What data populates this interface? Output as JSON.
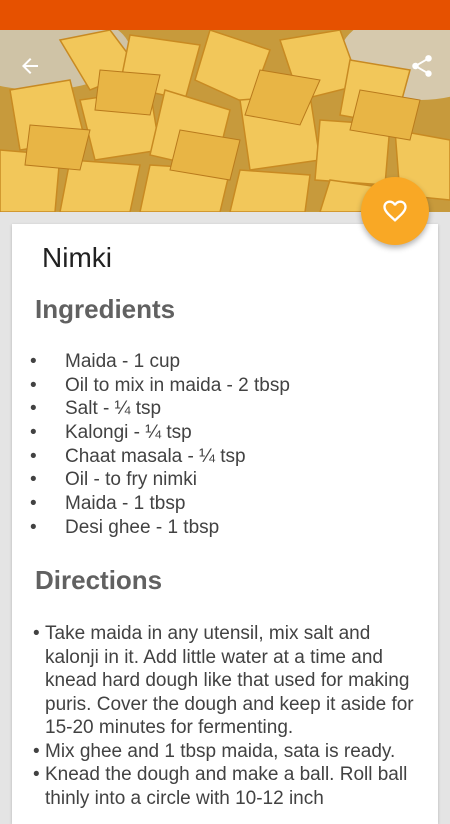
{
  "theme": {
    "status_bar_color": "#e65100",
    "fab_color": "#f9a825"
  },
  "header": {
    "back_icon": "arrow-back-icon",
    "share_icon": "share-icon",
    "favorite_icon": "heart-outline-icon"
  },
  "recipe": {
    "title": "Nimki",
    "ingredients_heading": "Ingredients",
    "ingredients": [
      "Maida - 1 cup",
      "Oil to mix in maida - 2 tbsp",
      "Salt - ¼ tsp",
      "Kalongi - ¼ tsp",
      "Chaat masala - ¼ tsp",
      "Oil - to fry nimki",
      "Maida - 1 tbsp",
      "Desi ghee - 1 tbsp"
    ],
    "directions_heading": "Directions",
    "directions": [
      "Take maida in any utensil, mix salt and kalonji in it. Add little water at a time and knead hard dough like that used for making puris. Cover the dough and keep it aside for 15-20 minutes for fermenting.",
      "Mix ghee and 1 tbsp maida, sata is ready.",
      "Knead the dough and make a ball. Roll ball thinly into a circle with 10-12 inch"
    ]
  }
}
